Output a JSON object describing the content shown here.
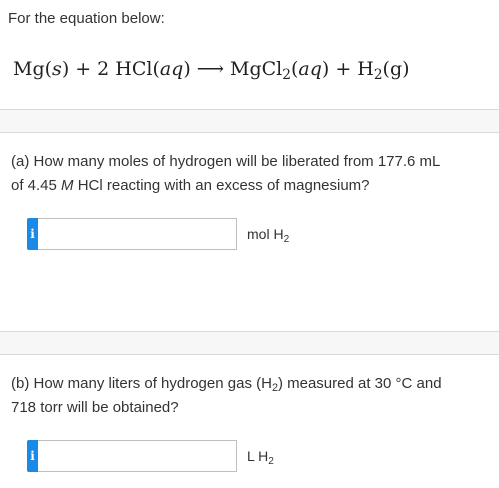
{
  "intro": "For the equation below:",
  "equation": {
    "reactant1": "Mg",
    "reactant1_state": "s",
    "plus1": "+",
    "coefficient": "2",
    "reactant2": "HCl",
    "reactant2_state": "aq",
    "arrow": "⟶",
    "product1_base": "MgCl",
    "product1_sub": "2",
    "product1_state": "aq",
    "plus2": "+",
    "product2_base": "H",
    "product2_sub": "2",
    "product2_state": "g"
  },
  "part_a": {
    "line1": "(a) How many moles of hydrogen will be liberated from 177.6 mL",
    "line2_pre": "of 4.45 ",
    "line2_unit": "M",
    "line2_post": " HCl reacting with an excess of magnesium?",
    "info_glyph": "i",
    "input_value": "",
    "unit_base": "mol H",
    "unit_sub": "2"
  },
  "part_b": {
    "line1_pre": "(b) How many liters of hydrogen gas (H",
    "line1_sub": "2",
    "line1_post": ") measured at 30 °C and",
    "line2": "718 torr will be obtained?",
    "info_glyph": "i",
    "input_value": "",
    "unit_base": "L H",
    "unit_sub": "2"
  },
  "colors": {
    "info_button": "#1a8ae6",
    "divider": "#d9d9d9",
    "input_border": "#bfbfbf"
  }
}
